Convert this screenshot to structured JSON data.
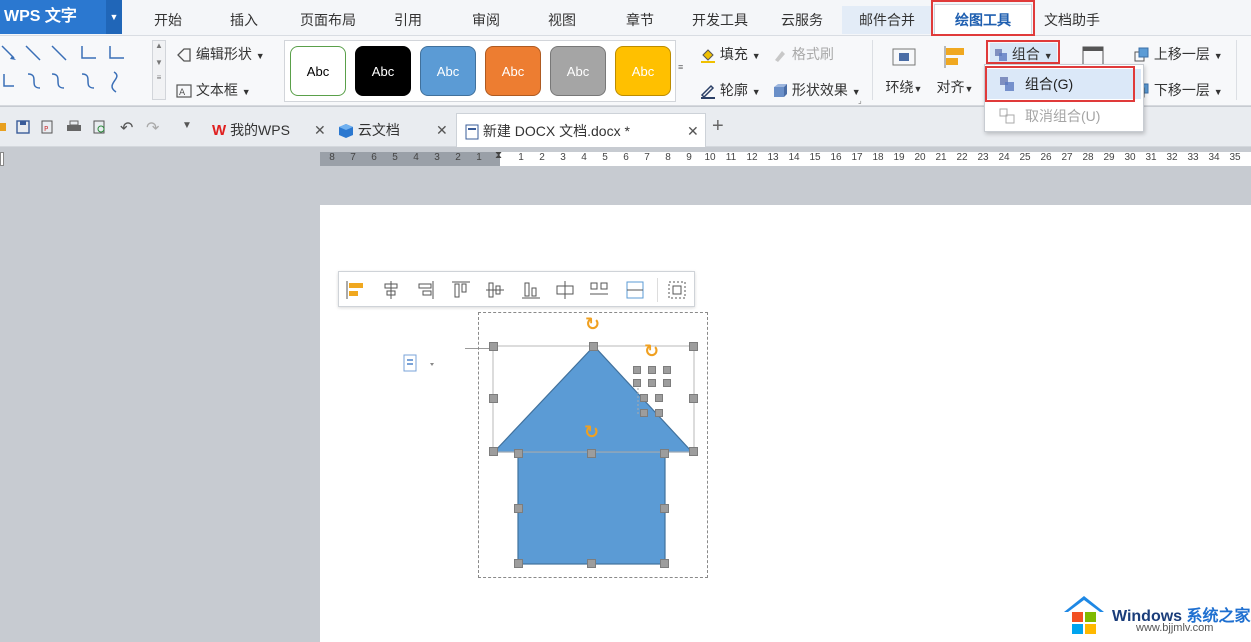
{
  "app": {
    "title": "WPS 文字"
  },
  "ribbon_tabs": [
    "开始",
    "插入",
    "页面布局",
    "引用",
    "审阅",
    "视图",
    "章节",
    "开发工具",
    "云服务",
    "邮件合并",
    "绘图工具",
    "文档助手"
  ],
  "ribbon": {
    "edit_shape": "编辑形状",
    "text_box": "文本框",
    "shape_styles": [
      "Abc",
      "Abc",
      "Abc",
      "Abc",
      "Abc",
      "Abc"
    ],
    "fill": "填充",
    "format_painter": "格式刷",
    "outline": "轮廓",
    "shape_effect": "形状效果",
    "wrap": "环绕",
    "align": "对齐",
    "group": "组合",
    "move_up": "上移一层",
    "move_down": "下移一层"
  },
  "dropdown": {
    "group": "组合(G)",
    "ungroup": "取消组合(U)"
  },
  "doc_tabs": [
    {
      "label": "我的WPS"
    },
    {
      "label": "云文档"
    },
    {
      "label": "新建 DOCX 文档.docx *"
    }
  ],
  "ruler": {
    "left": [
      "8",
      "7",
      "6",
      "5",
      "4",
      "3",
      "2",
      "1"
    ],
    "right": [
      "1",
      "2",
      "3",
      "4",
      "5",
      "6",
      "7",
      "8",
      "9",
      "10",
      "11",
      "12",
      "13",
      "14",
      "15",
      "16",
      "17",
      "18",
      "19",
      "20",
      "21",
      "22",
      "23",
      "24",
      "25",
      "26",
      "27",
      "28",
      "29",
      "30",
      "31",
      "32",
      "33",
      "34",
      "35"
    ]
  },
  "watermark": {
    "brand": "Windows",
    "suffix": "系统之家",
    "url": "www.bjjmlv.com"
  },
  "colors": {
    "accent": "#2b78d0",
    "shape_fill": "#5b9bd5",
    "highlight": "#e03a3a"
  }
}
